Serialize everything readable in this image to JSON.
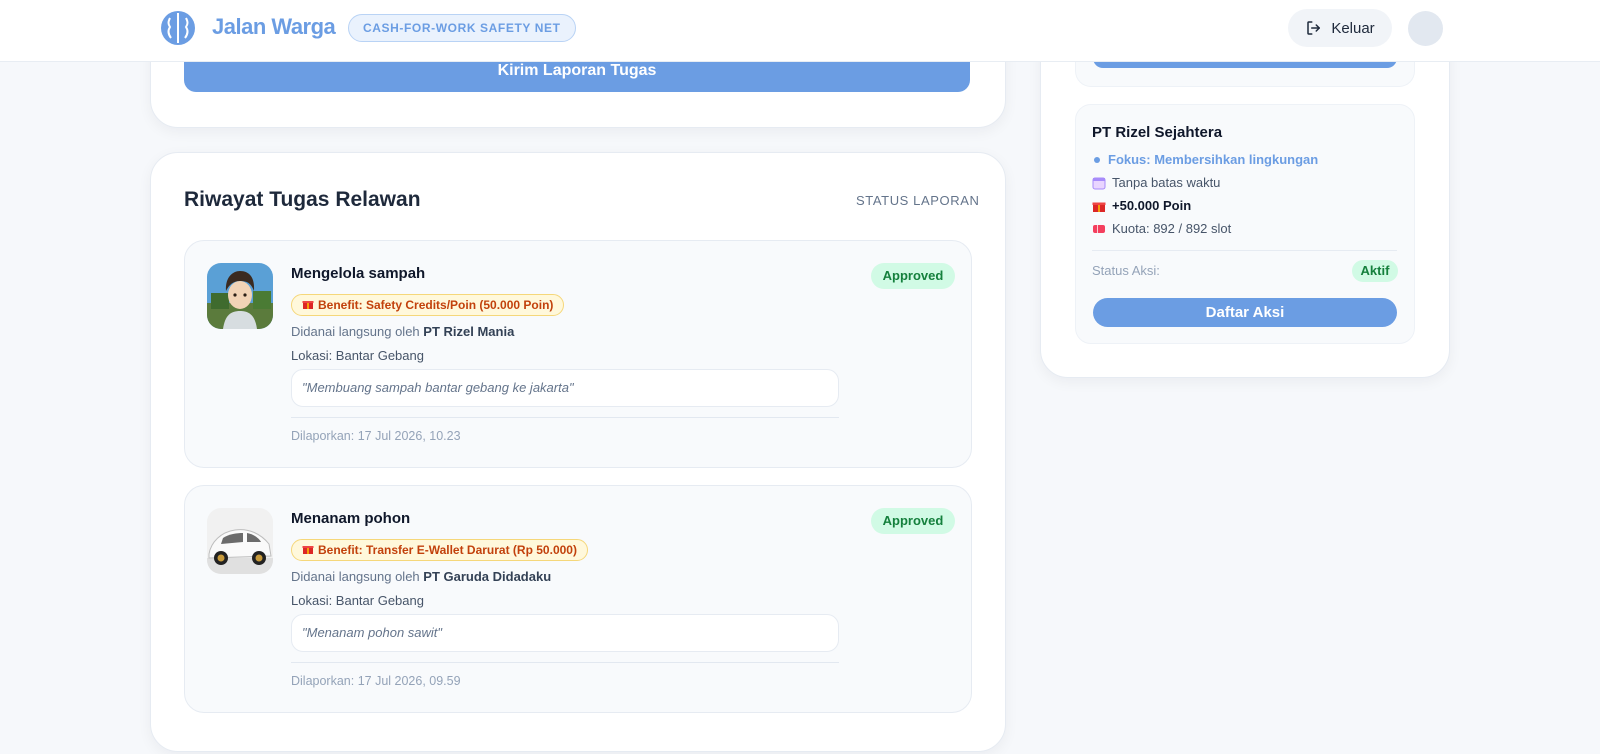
{
  "header": {
    "brand": "Jalan Warga",
    "tagline": "CASH-FOR-WORK SAFETY NET",
    "logout_label": "Keluar"
  },
  "report_form": {
    "submit_label": "Kirim Laporan Tugas"
  },
  "history": {
    "title": "Riwayat Tugas Relawan",
    "aside": "STATUS LAPORAN",
    "items": [
      {
        "title": "Mengelola sampah",
        "benefit": "Benefit: Safety Credits/Poin (50.000 Poin)",
        "funded_prefix": "Didanai langsung oleh",
        "funder": "PT Rizel Mania",
        "location": "Lokasi: Bantar Gebang",
        "quote": "\"Membuang sampah bantar gebang ke jakarta\"",
        "reported": "Dilaporkan: 17 Jul 2026, 10.23",
        "status": "Approved",
        "image": "anime-boy-avatar"
      },
      {
        "title": "Menanam pohon",
        "benefit": "Benefit: Transfer E-Wallet Darurat (Rp 50.000)",
        "funded_prefix": "Didanai langsung oleh",
        "funder": "PT Garuda Didadaku",
        "location": "Lokasi: Bantar Gebang",
        "quote": "\"Menanam pohon sawit\"",
        "reported": "Dilaporkan: 17 Jul 2026, 09.59",
        "status": "Approved",
        "image": "white-car-photo"
      }
    ]
  },
  "program": {
    "title": "PT Rizel Sejahtera",
    "focus": "Fokus: Membersihkan lingkungan",
    "deadline": "Tanpa batas waktu",
    "points": "+50.000 Poin",
    "quota": "Kuota: 892 / 892 slot",
    "status_label": "Status Aksi:",
    "status_value": "Aktif",
    "register_label": "Daftar Aksi"
  },
  "colors": {
    "accent": "#6b9de3",
    "success_bg": "#d1fae5",
    "success_text": "#15803d",
    "benefit_text": "#c2410c"
  }
}
